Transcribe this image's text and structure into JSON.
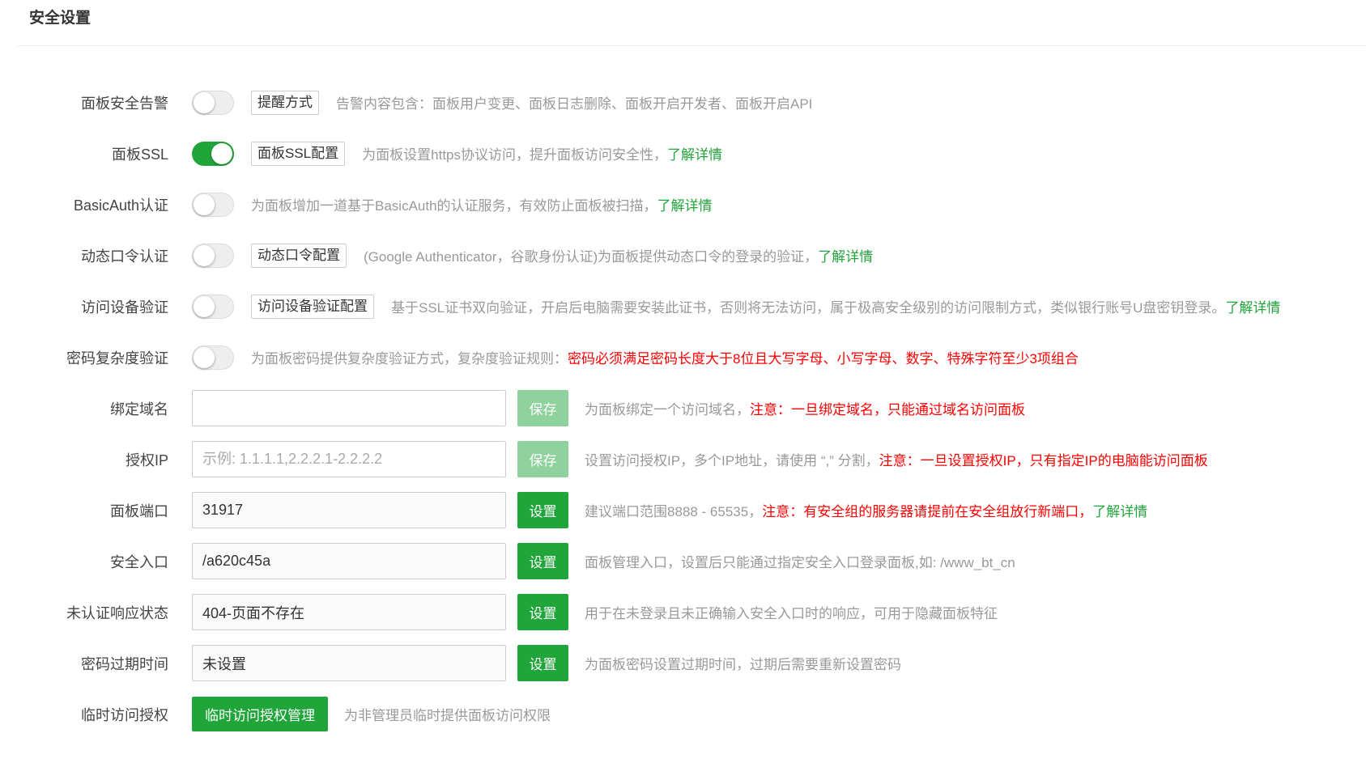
{
  "header": {
    "title": "安全设置"
  },
  "colors": {
    "accent": "#20a53a",
    "warning": "#ff0000",
    "disabled_button": "#90d29d"
  },
  "rows": [
    {
      "label": "面板安全告警",
      "toggle_on": false,
      "button": "提醒方式",
      "desc": "告警内容包含：面板用户变更、面板日志删除、面板开启开发者、面板开启API"
    },
    {
      "label": "面板SSL",
      "toggle_on": true,
      "button": "面板SSL配置",
      "desc": "为面板设置https协议访问，提升面板访问安全性，",
      "link": "了解详情"
    },
    {
      "label": "BasicAuth认证",
      "toggle_on": false,
      "desc": "为面板增加一道基于BasicAuth的认证服务，有效防止面板被扫描，",
      "link": "了解详情"
    },
    {
      "label": "动态口令认证",
      "toggle_on": false,
      "button": "动态口令配置",
      "desc": "(Google Authenticator，谷歌身份认证)为面板提供动态口令的登录的验证，",
      "link": "了解详情"
    },
    {
      "label": "访问设备验证",
      "toggle_on": false,
      "button": "访问设备验证配置",
      "desc": "基于SSL证书双向验证，开启后电脑需要安装此证书，否则将无法访问，属于极高安全级别的访问限制方式，类似银行账号U盘密钥登录。",
      "link": "了解详情"
    },
    {
      "label": "密码复杂度验证",
      "toggle_on": false,
      "desc": "为面板密码提供复杂度验证方式，复杂度验证规则：",
      "warning": "密码必须满足密码长度大于8位且大写字母、小写字母、数字、特殊字符至少3项组合"
    },
    {
      "label": "绑定域名",
      "value": "",
      "button": "保存",
      "desc": "为面板绑定一个访问域名，",
      "warning": "注意：一旦绑定域名，只能通过域名访问面板"
    },
    {
      "label": "授权IP",
      "value": "",
      "placeholder": "示例: 1.1.1.1,2.2.2.1-2.2.2.2",
      "button": "保存",
      "desc": "设置访问授权IP，多个IP地址，请使用 “,” 分割，",
      "warning": "注意：一旦设置授权IP，只有指定IP的电脑能访问面板"
    },
    {
      "label": "面板端口",
      "value": "31917",
      "button": "设置",
      "desc": "建议端口范围8888 - 65535，",
      "warning": "注意：有安全组的服务器请提前在安全组放行新端口，",
      "link": "了解详情"
    },
    {
      "label": "安全入口",
      "value": "/a620c45a",
      "button": "设置",
      "desc": "面板管理入口，设置后只能通过指定安全入口登录面板,如: /www_bt_cn"
    },
    {
      "label": "未认证响应状态",
      "value": "404-页面不存在",
      "button": "设置",
      "desc": "用于在未登录且未正确输入安全入口时的响应，可用于隐藏面板特征"
    },
    {
      "label": "密码过期时间",
      "value": "未设置",
      "button": "设置",
      "desc": "为面板密码设置过期时间，过期后需要重新设置密码"
    },
    {
      "label": "临时访问授权",
      "button": "临时访问授权管理",
      "desc": "为非管理员临时提供面板访问权限"
    }
  ]
}
